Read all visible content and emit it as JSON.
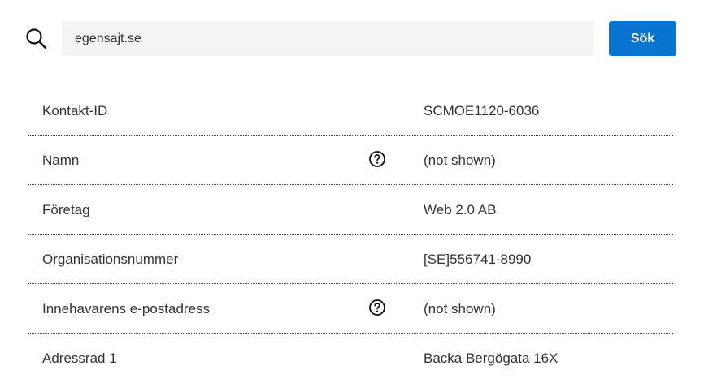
{
  "search": {
    "value": "egensajt.se",
    "button_label": "Sök",
    "icon": "search-icon"
  },
  "colors": {
    "accent": "#0a74d1",
    "input_background": "#f3f3f3",
    "text": "#333333"
  },
  "records": [
    {
      "label": "Kontakt-ID",
      "value": "SCMOE1120-6036",
      "has_help": false
    },
    {
      "label": "Namn",
      "value": "(not shown)",
      "has_help": true,
      "help_icon": "help-circle-icon"
    },
    {
      "label": "Företag",
      "value": "Web 2.0 AB",
      "has_help": false
    },
    {
      "label": "Organisationsnummer",
      "value": "[SE]556741-8990",
      "has_help": false
    },
    {
      "label": "Innehavarens e-postadress",
      "value": "(not shown)",
      "has_help": true,
      "help_icon": "help-circle-icon"
    },
    {
      "label": "Adressrad 1",
      "value": "Backa Bergögata 16X",
      "has_help": false
    }
  ]
}
